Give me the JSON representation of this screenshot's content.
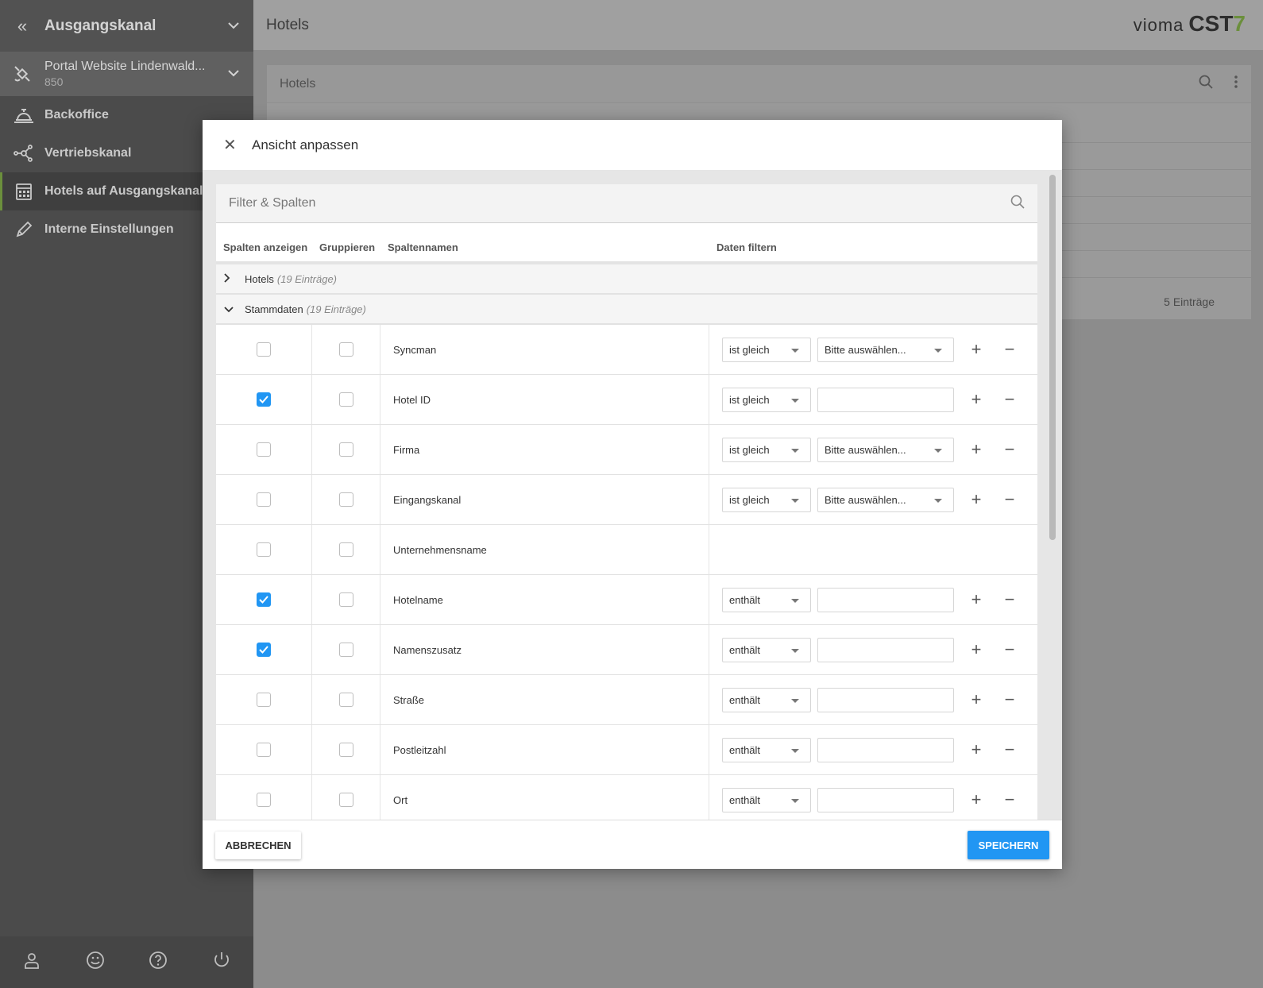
{
  "sidebar": {
    "header_title": "Ausgangskanal",
    "channel": {
      "name": "Portal Website Lindenwald...",
      "id": "850"
    },
    "items": [
      {
        "label": "Backoffice",
        "icon": "bell-icon"
      },
      {
        "label": "Vertriebskanal",
        "icon": "network-icon"
      },
      {
        "label": "Hotels auf Ausgangskanal",
        "icon": "calendar-icon",
        "active": true
      },
      {
        "label": "Interne Einstellungen",
        "icon": "pencil-icon"
      }
    ]
  },
  "topbar": {
    "title": "Hotels",
    "brand_prefix": "vioma",
    "brand_name": "CST",
    "brand_number": "7"
  },
  "card": {
    "title": "Hotels",
    "count": "5 Einträge"
  },
  "modal": {
    "title": "Ansicht anpassen",
    "search_placeholder": "Filter & Spalten",
    "columns": {
      "show": "Spalten anzeigen",
      "group": "Gruppieren",
      "name": "Spaltennamen",
      "filter": "Daten filtern"
    },
    "groups": [
      {
        "name": "Hotels",
        "count": "(19 Einträge)",
        "expanded": false
      },
      {
        "name": "Stammdaten",
        "count": "(19 Einträge)",
        "expanded": true
      }
    ],
    "rows": [
      {
        "name": "Syncman",
        "show": false,
        "group": false,
        "op": "ist gleich",
        "value_type": "select",
        "value": "Bitte auswählen..."
      },
      {
        "name": "Hotel ID",
        "show": true,
        "group": false,
        "op": "ist gleich",
        "value_type": "input",
        "value": ""
      },
      {
        "name": "Firma",
        "show": false,
        "group": false,
        "op": "ist gleich",
        "value_type": "select",
        "value": "Bitte auswählen..."
      },
      {
        "name": "Eingangskanal",
        "show": false,
        "group": false,
        "op": "ist gleich",
        "value_type": "select",
        "value": "Bitte auswählen..."
      },
      {
        "name": "Unternehmensname",
        "show": false,
        "group": false,
        "op": "",
        "value_type": "none",
        "value": ""
      },
      {
        "name": "Hotelname",
        "show": true,
        "group": false,
        "op": "enthält",
        "value_type": "input",
        "value": ""
      },
      {
        "name": "Namenszusatz",
        "show": true,
        "group": false,
        "op": "enthält",
        "value_type": "input",
        "value": ""
      },
      {
        "name": "Straße",
        "show": false,
        "group": false,
        "op": "enthält",
        "value_type": "input",
        "value": ""
      },
      {
        "name": "Postleitzahl",
        "show": false,
        "group": false,
        "op": "enthält",
        "value_type": "input",
        "value": ""
      },
      {
        "name": "Ort",
        "show": false,
        "group": false,
        "op": "enthält",
        "value_type": "input",
        "value": ""
      }
    ],
    "cancel_label": "ABBRECHEN",
    "save_label": "SPEICHERN",
    "accent": "#2196f3"
  }
}
